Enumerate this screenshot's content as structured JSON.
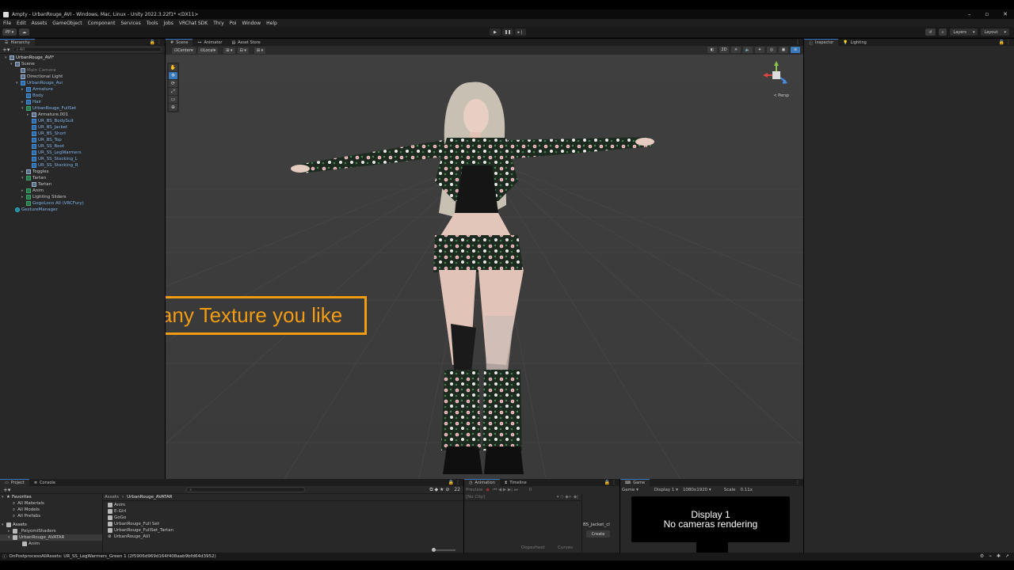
{
  "window": {
    "title": "Ampty - UrbanRouge_AVI - Windows, Mac, Linux - Unity 2022.3.22f1* <DX11>",
    "controls": [
      "–",
      "▫",
      "✕"
    ]
  },
  "menu": [
    "File",
    "Edit",
    "Assets",
    "GameObject",
    "Component",
    "Services",
    "Tools",
    "Jobs",
    "VRChat SDK",
    "Thry",
    "Poi",
    "Window",
    "Help"
  ],
  "toolbar": {
    "account": "PP",
    "layers": "Layers",
    "layout": "Layout"
  },
  "hierarchy": {
    "tab": "Hierarchy",
    "search_placeholder": "All",
    "items": [
      {
        "label": "UrbanRouge_AVI*",
        "depth": 0,
        "icon": "unity-icon",
        "style": "white",
        "arrow": "▾"
      },
      {
        "label": "Scene",
        "depth": 1,
        "icon": "obj",
        "style": "normal",
        "arrow": "▾"
      },
      {
        "label": "Main Camera",
        "depth": 2,
        "icon": "obj",
        "style": "dim",
        "arrow": ""
      },
      {
        "label": "Directional Light",
        "depth": 2,
        "icon": "obj",
        "style": "normal",
        "arrow": ""
      },
      {
        "label": "UrbanRouge_Avi",
        "depth": 2,
        "icon": "pre",
        "style": "blue",
        "arrow": "▾"
      },
      {
        "label": "Armature",
        "depth": 3,
        "icon": "pre",
        "style": "blue",
        "arrow": "▸"
      },
      {
        "label": "Body",
        "depth": 3,
        "icon": "pre",
        "style": "blue",
        "arrow": ""
      },
      {
        "label": "Hair",
        "depth": 3,
        "icon": "pre",
        "style": "blue",
        "arrow": "▸"
      },
      {
        "label": "UrbanRouge_FullSet",
        "depth": 3,
        "icon": "green",
        "style": "blue",
        "arrow": "▾"
      },
      {
        "label": "Armature.001",
        "depth": 4,
        "icon": "obj",
        "style": "normal",
        "arrow": "▸"
      },
      {
        "label": "UR_BS_BodySuit",
        "depth": 4,
        "icon": "pre",
        "style": "blue",
        "arrow": ""
      },
      {
        "label": "UR_BS_Jacket",
        "depth": 4,
        "icon": "pre",
        "style": "blue",
        "arrow": ""
      },
      {
        "label": "UR_BS_Short",
        "depth": 4,
        "icon": "pre",
        "style": "blue",
        "arrow": ""
      },
      {
        "label": "UR_BS_Top",
        "depth": 4,
        "icon": "pre",
        "style": "blue",
        "arrow": ""
      },
      {
        "label": "UR_SS_Boot",
        "depth": 4,
        "icon": "pre",
        "style": "blue",
        "arrow": ""
      },
      {
        "label": "UR_SS_LegWarmers",
        "depth": 4,
        "icon": "pre",
        "style": "blue",
        "arrow": ""
      },
      {
        "label": "UR_SS_Stocking_L",
        "depth": 4,
        "icon": "pre",
        "style": "blue",
        "arrow": ""
      },
      {
        "label": "UR_SS_Stocking_R",
        "depth": 4,
        "icon": "pre",
        "style": "blue",
        "arrow": ""
      },
      {
        "label": "Toggles",
        "depth": 3,
        "icon": "obj",
        "style": "normal",
        "arrow": "▸"
      },
      {
        "label": "Tartan",
        "depth": 3,
        "icon": "green",
        "style": "normal",
        "arrow": "▾"
      },
      {
        "label": "Tartan",
        "depth": 4,
        "icon": "obj",
        "style": "normal",
        "arrow": ""
      },
      {
        "label": "Anim",
        "depth": 3,
        "icon": "green",
        "style": "normal",
        "arrow": "▸"
      },
      {
        "label": "Lighting Sliders",
        "depth": 3,
        "icon": "green",
        "style": "normal",
        "arrow": "▸"
      },
      {
        "label": "GogoLoco All (VRCFury)",
        "depth": 3,
        "icon": "green",
        "style": "blue",
        "arrow": ""
      },
      {
        "label": "GestureManager",
        "depth": 1,
        "icon": "cyan",
        "style": "blue",
        "arrow": ""
      }
    ]
  },
  "scene": {
    "tabs": [
      "Scene",
      "Animator",
      "Asset Store"
    ],
    "pivot": "Center",
    "space": "Local",
    "mode_2d": "2D",
    "persp_label": "< Persp",
    "tools": [
      "✋",
      "✥",
      "⟳",
      "⤢",
      "▭",
      "⊕"
    ]
  },
  "inspector": {
    "tabs": [
      "Inspector",
      "Lighting"
    ]
  },
  "caption": "use any Texture you like",
  "project": {
    "tabs": [
      "Project",
      "Console"
    ],
    "favorites_label": "Favorites",
    "favorites": [
      "All Materials",
      "All Models",
      "All Prefabs"
    ],
    "assets_label": "Assets",
    "asset_tree": [
      "_PoiyomiShaders",
      "UrbanRouge_AVATAR",
      "Anim"
    ],
    "breadcrumb": [
      "Assets",
      "UrbanRouge_AVATAR"
    ],
    "files": [
      "Anim",
      "E-Girl",
      "GoGo",
      "UrbanRouge_Full Set",
      "UrbanRouge_FullSet_Tartan",
      "UrbanRouge_AVI"
    ],
    "count": "22"
  },
  "animation": {
    "tabs": [
      "Animation",
      "Timeline"
    ],
    "preview_label": "Preview",
    "frame": "0",
    "clip": "[No Clip]",
    "object_label": "BS_Jacket_cl",
    "create_label": "Create",
    "dopesheet_label": "Dopesheet",
    "curves_label": "Curves"
  },
  "game": {
    "tab": "Game",
    "mode": "Game",
    "display": "Display 1",
    "resolution": "1080x1920",
    "scale_label": "Scale",
    "scale_value": "0.11x",
    "message_line1": "Display 1",
    "message_line2": "No cameras rendering"
  },
  "status": {
    "text": "OnPostprocessAllAssets: UR_SS_LegWarmers_Green 1 (2f5906d969d164f408aab9bfd64d3952)"
  },
  "colors": {
    "accent": "#3a79bb",
    "caption": "#f39c12",
    "viewport": "#3d3d3d"
  }
}
